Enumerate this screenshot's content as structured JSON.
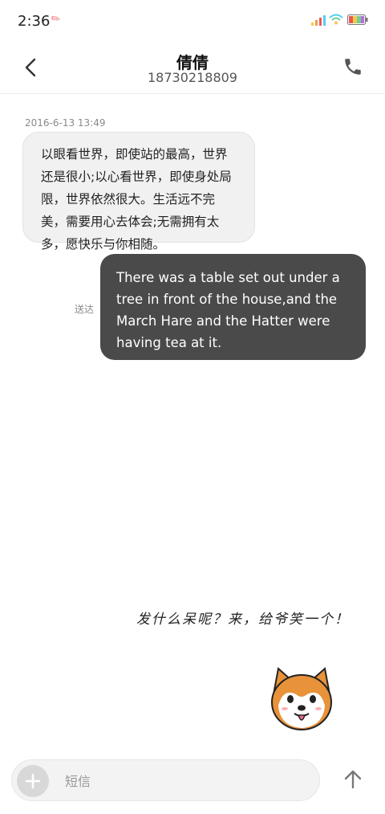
{
  "status_bar": {
    "time": "2:36"
  },
  "header": {
    "contact_name": "倩倩",
    "contact_number": "18730218809"
  },
  "thread": {
    "timestamp": "2016-6-13 13:49",
    "incoming_text": "以眼看世界，即使站的最高，世界还是很小;以心看世界，即使身处局限，世界依然很大。生活远不完美，需要用心去体会;无需拥有太多，愿快乐与你相随。",
    "outgoing_text": "There was a table set out under a tree in front of the house,and the March Hare and the Hatter were having tea at it.",
    "outgoing_status": "送达"
  },
  "empty_state": {
    "tease_text": "发什么呆呢？来，给爷笑一个！"
  },
  "composer": {
    "placeholder": "短信"
  },
  "colors": {
    "outgoing_bubble": "#4a4a4a",
    "incoming_bubble": "#f1f1f1",
    "accent_dog": "#e8923a"
  }
}
